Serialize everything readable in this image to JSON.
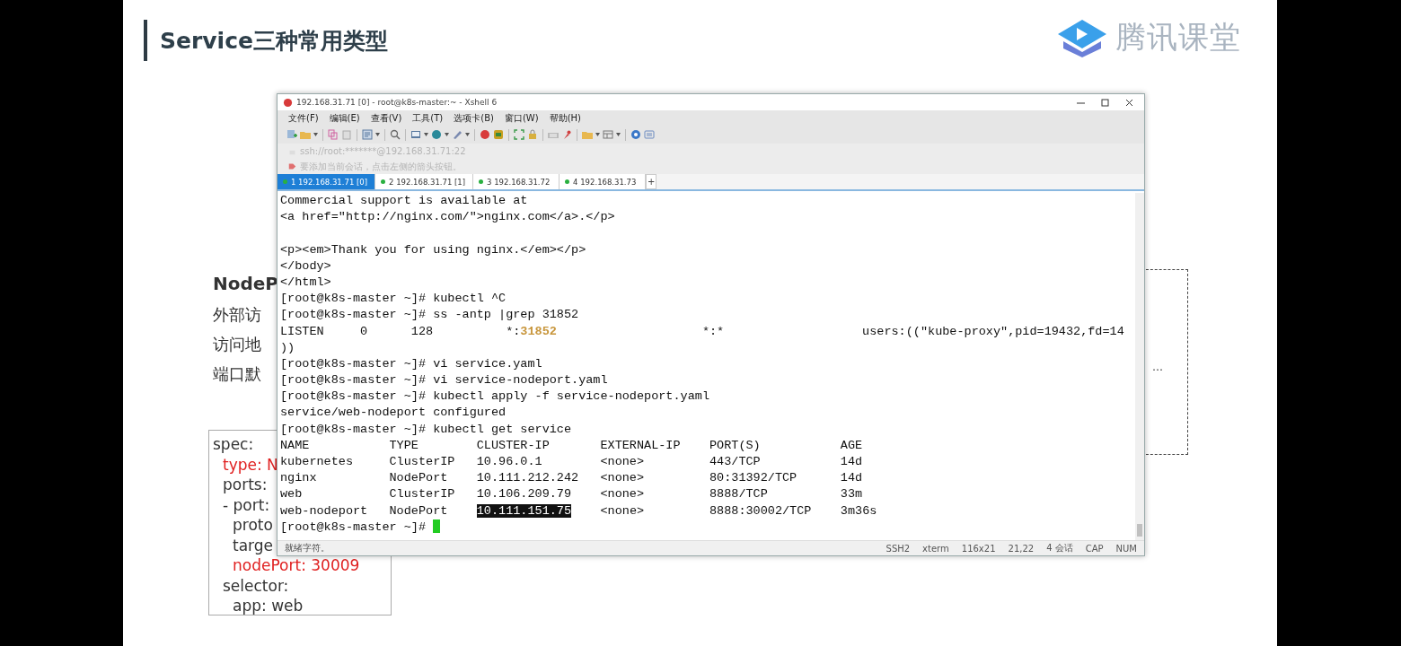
{
  "slide": {
    "title": "Service三种常用类型",
    "logo_text": "腾讯课堂",
    "heading": "NodeP",
    "lines": [
      "外部访",
      "访问地",
      "端口默"
    ],
    "code": [
      {
        "text": "spec:",
        "highlighted": false,
        "children": [
          {
            "text": "type: N",
            "highlighted": true
          },
          {
            "text": "ports:",
            "highlighted": false
          },
          {
            "text": "- port:",
            "highlighted": false,
            "children": [
              {
                "text": "proto",
                "highlighted": false
              },
              {
                "text": "targe",
                "highlighted": false
              },
              {
                "text": "nodePort: 30009",
                "highlighted": true
              }
            ]
          },
          {
            "text": "selector:",
            "highlighted": false,
            "children": [
              {
                "text": "app: web",
                "highlighted": false
              }
            ]
          }
        ]
      }
    ],
    "dashed_note": "…"
  },
  "window": {
    "title": "192.168.31.71 [0] - root@k8s-master:~ - Xshell 6",
    "menu": [
      "文件(F)",
      "编辑(E)",
      "查看(V)",
      "工具(T)",
      "选项卡(B)",
      "窗口(W)",
      "帮助(H)"
    ],
    "address": "ssh://root:*******@192.168.31.71:22",
    "hint": "要添加当前会话，点击左侧的箭头按钮。",
    "tabs": [
      {
        "label": "1 192.168.31.71 [0]",
        "selected": true
      },
      {
        "label": "2 192.168.31.71 [1]",
        "selected": false
      },
      {
        "label": "3 192.168.31.72",
        "selected": false
      },
      {
        "label": "4 192.168.31.73",
        "selected": false
      }
    ],
    "new_tab": "+",
    "terminal": {
      "lines": [
        {
          "kind": "text",
          "text": "Commercial support is available at"
        },
        {
          "kind": "text",
          "text": "<a href=\"http://nginx.com/\">nginx.com</a>.</p>"
        },
        {
          "kind": "blank"
        },
        {
          "kind": "text",
          "text": "<p><em>Thank you for using nginx.</em></p>"
        },
        {
          "kind": "text",
          "text": "</body>"
        },
        {
          "kind": "text",
          "text": "</html>"
        },
        {
          "kind": "text",
          "text": "[root@k8s-master ~]# kubectl ^C"
        },
        {
          "kind": "text",
          "text": "[root@k8s-master ~]# ss -antp |grep 31852"
        },
        {
          "kind": "mixed",
          "parts": [
            {
              "kind": "plain",
              "text": "LISTEN     0      128          *:"
            },
            {
              "kind": "port",
              "text": "31852"
            },
            {
              "kind": "plain",
              "text": "                    *:*                   users:((\"kube-proxy\",pid=19432,fd=14"
            }
          ]
        },
        {
          "kind": "text",
          "text": "))"
        },
        {
          "kind": "text",
          "text": "[root@k8s-master ~]# vi service.yaml"
        },
        {
          "kind": "text",
          "text": "[root@k8s-master ~]# vi service-nodeport.yaml"
        },
        {
          "kind": "text",
          "text": "[root@k8s-master ~]# kubectl apply -f service-nodeport.yaml"
        },
        {
          "kind": "text",
          "text": "service/web-nodeport configured"
        },
        {
          "kind": "text",
          "text": "[root@k8s-master ~]# kubectl get service"
        },
        {
          "kind": "text",
          "text": "NAME           TYPE        CLUSTER-IP       EXTERNAL-IP    PORT(S)           AGE"
        },
        {
          "kind": "text",
          "text": "kubernetes     ClusterIP   10.96.0.1        <none>         443/TCP           14d"
        },
        {
          "kind": "text",
          "text": "nginx          NodePort    10.111.212.242   <none>         80:31392/TCP      14d"
        },
        {
          "kind": "text",
          "text": "web            ClusterIP   10.106.209.79    <none>         8888/TCP          33m"
        },
        {
          "kind": "mixed",
          "parts": [
            {
              "kind": "plain",
              "text": "web-nodeport   NodePort    "
            },
            {
              "kind": "selected",
              "text": "10.111.151.75"
            },
            {
              "kind": "plain",
              "text": "    <none>         8888:30002/TCP    3m36s"
            }
          ]
        },
        {
          "kind": "prompt",
          "text": "[root@k8s-master ~]#"
        }
      ]
    },
    "status_bar": {
      "message": "就绪字符。",
      "items": [
        "SSH2",
        "xterm",
        "116x21",
        "21,22",
        "4 会话",
        "CAP",
        "NUM"
      ]
    }
  }
}
